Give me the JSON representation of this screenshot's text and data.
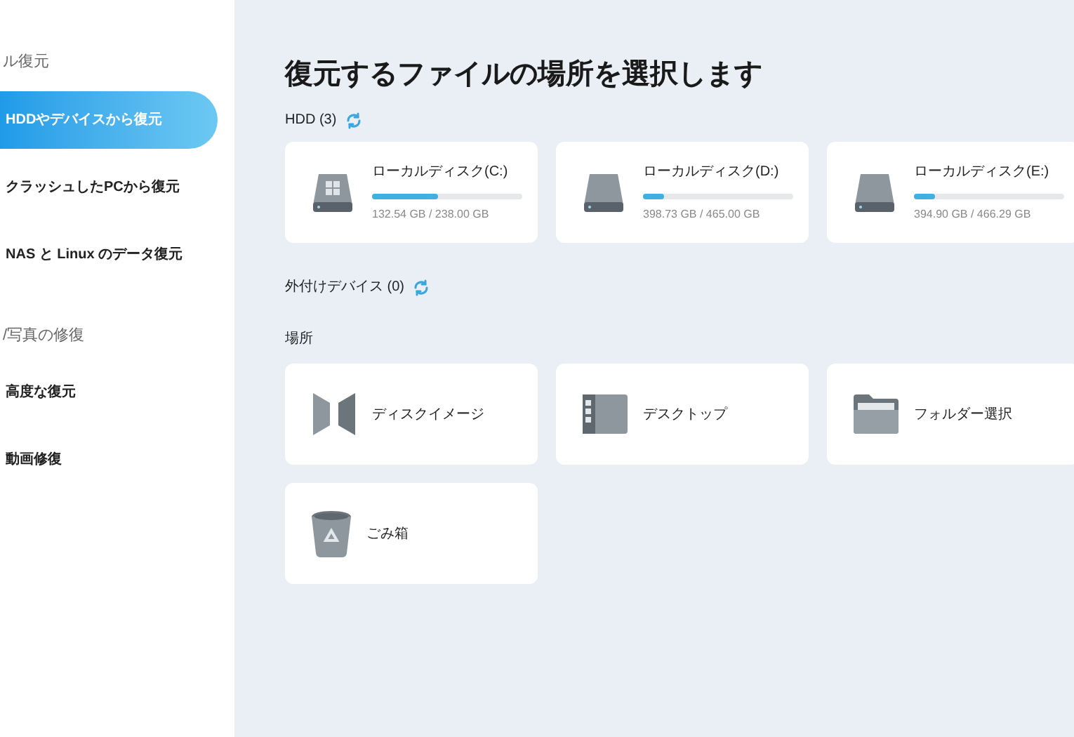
{
  "sidebar": {
    "sections": [
      {
        "heading": "ル復元",
        "items": [
          {
            "label": "HDDやデバイスから復元",
            "selected": true
          },
          {
            "label": "クラッシュしたPCから復元",
            "selected": false
          },
          {
            "label": "NAS と Linux のデータ復元",
            "selected": false
          }
        ]
      },
      {
        "heading": "/写真の修復",
        "items": [
          {
            "label": "高度な復元",
            "selected": false
          },
          {
            "label": "動画修復",
            "selected": false
          }
        ]
      }
    ]
  },
  "main": {
    "title": "復元するファイルの場所を選択します",
    "hdd": {
      "label": "HDD (3)",
      "drives": [
        {
          "name": "ローカルディスク(C:)",
          "kind": "system",
          "level": 0.44,
          "usage": "132.54 GB / 238.00 GB"
        },
        {
          "name": "ローカルディスク(D:)",
          "kind": "data",
          "level": 0.14,
          "usage": "398.73 GB / 465.00 GB"
        },
        {
          "name": "ローカルディスク(E:)",
          "kind": "data",
          "level": 0.14,
          "usage": "394.90 GB / 466.29 GB"
        }
      ]
    },
    "external": {
      "label": "外付けデバイス (0)"
    },
    "locations": {
      "label": "場所",
      "items": [
        {
          "name": "ディスクイメージ",
          "kind": "disk-image"
        },
        {
          "name": "デスクトップ",
          "kind": "desktop"
        },
        {
          "name": "フォルダー選択",
          "kind": "folder"
        },
        {
          "name": "ごみ箱",
          "kind": "trash"
        }
      ]
    }
  }
}
